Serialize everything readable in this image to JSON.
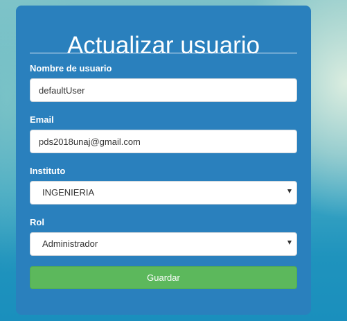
{
  "form": {
    "title": "Actualizar usuario",
    "username": {
      "label": "Nombre de usuario",
      "value": "defaultUser"
    },
    "email": {
      "label": "Email",
      "value": "pds2018unaj@gmail.com"
    },
    "instituto": {
      "label": "Instituto",
      "selected": "INGENIERIA"
    },
    "rol": {
      "label": "Rol",
      "selected": "Administrador"
    },
    "save_label": "Guardar"
  },
  "colors": {
    "card": "#2a80bd",
    "save_button": "#5cb85c",
    "text": "#ffffff"
  }
}
